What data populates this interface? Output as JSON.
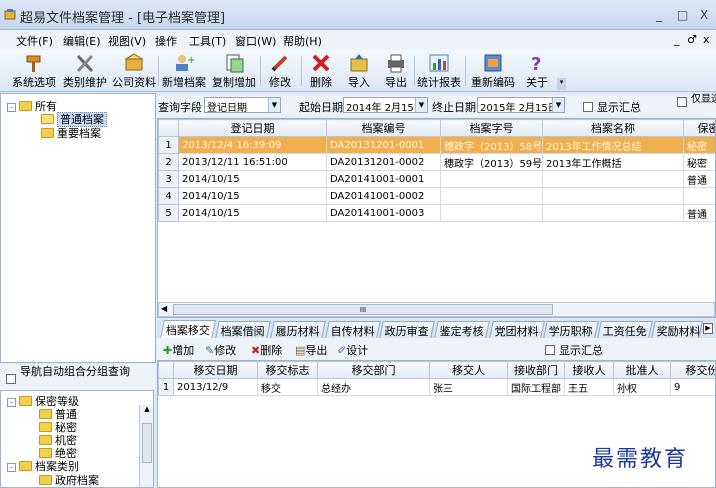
{
  "window": {
    "title": "超易文件档案管理 - [电子档案管理]",
    "min": "_",
    "max": "□",
    "close": "X",
    "child_min": "_",
    "child_restore": "♂",
    "child_close": "x"
  },
  "menu": [
    "文件(F)",
    "编辑(E)",
    "视图(V)",
    "操作",
    "工具(T)",
    "窗口(W)",
    "帮助(H)"
  ],
  "toolbar": [
    "系统选项",
    "类别维护",
    "公司资料",
    "新增档案",
    "复制增加",
    "修改",
    "删除",
    "导入",
    "导出",
    "统计报表",
    "重新编码",
    "关于"
  ],
  "tree_top": {
    "root": "所有",
    "items": [
      "普通档案",
      "重要档案"
    ]
  },
  "nav_option": {
    "label": "导航自动组合分组查询"
  },
  "tree_bottom": {
    "groups": [
      {
        "label": "保密等级",
        "items": [
          "普通",
          "秘密",
          "机密",
          "绝密"
        ]
      },
      {
        "label": "档案类别",
        "items": [
          "政府档案"
        ]
      }
    ]
  },
  "query": {
    "field_label": "查询字段",
    "field_value": "登记日期",
    "start_label": "起始日期",
    "start_value": "2014年 2月15日",
    "end_label": "终止日期",
    "end_value": "2015年 2月15日",
    "show_summary": "显示汇总",
    "only_selected": "仅显选定"
  },
  "main_table": {
    "columns": [
      "",
      "登记日期",
      "档案编号",
      "档案字号",
      "档案名称",
      "保密"
    ],
    "rows": [
      [
        "1",
        "2013/12/4 16:39:09",
        "DA20131201-0001",
        "穗政字（2013）58号",
        "2013年工作情况总结",
        "秘密"
      ],
      [
        "2",
        "2013/12/11 16:51:00",
        "DA20131201-0002",
        "穗政字（2013）59号",
        "2013年工作概括",
        "秘密"
      ],
      [
        "3",
        "2014/10/15",
        "DA20141001-0001",
        "",
        "",
        "普通"
      ],
      [
        "4",
        "2014/10/15",
        "DA20141001-0002",
        "",
        "",
        ""
      ],
      [
        "5",
        "2014/10/15",
        "DA20141001-0003",
        "",
        "",
        "普通"
      ]
    ]
  },
  "tabs": [
    "档案移交",
    "档案借阅",
    "履历材料",
    "自传材料",
    "政历审查",
    "鉴定考核",
    "党团材料",
    "学历职称",
    "工资任免",
    "奖励材料"
  ],
  "subtoolbar": {
    "add": "增加",
    "edit": "修改",
    "delete": "删除",
    "export": "导出",
    "design": "设计",
    "show_summary": "显示汇总"
  },
  "transfer_table": {
    "columns": [
      "",
      "移交日期",
      "移交标志",
      "移交部门",
      "移交人",
      "接收部门",
      "接收人",
      "批准人",
      "移交份"
    ],
    "rows": [
      [
        "1",
        "2013/12/9",
        "移交",
        "总经办",
        "张三",
        "国际工程部",
        "王五",
        "孙权",
        "9"
      ]
    ]
  },
  "scroll_mark": "III",
  "watermark": "最需教育",
  "colors": {
    "highlight_row": "#f0b050",
    "accent": "#1d3a9a"
  }
}
